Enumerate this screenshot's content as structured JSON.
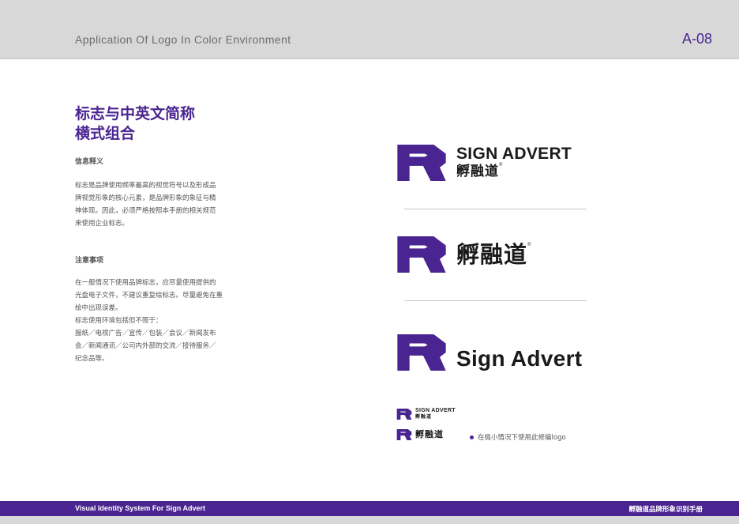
{
  "header": {
    "title": "Application Of Logo In Color Environment",
    "page_number": "A-08"
  },
  "left": {
    "title_line1": "标志与中英文简称",
    "title_line2": "横式组合",
    "section1_label": "信息释义",
    "section1_lines": [
      "标志是品牌使用频率最高的视觉符号以及形成品",
      "牌视觉形象的核心元素，是品牌形象的象征与精",
      "神体现。因此，必须严格按照本手册的相关规范",
      "来使用企业标志。"
    ],
    "section2_label": "注意事项",
    "section2_lines": [
      "在一般情况下使用品牌标志，应尽量使用提供的",
      "光盘电子文件，不建议重复绘标志。尽量避免在重",
      "绘中出现误差。",
      "标志使用环境包括但不限于：",
      "报纸／电视广告／宣传／包装／会议／新闻发布",
      "会／新闻通讯／公司内外部的交流／接待服务／",
      "纪念品等。"
    ]
  },
  "logos": {
    "brand_en_upper": "SIGN ADVERT",
    "brand_cn": "孵融道",
    "brand_en_mixed": "Sign Advert",
    "registered": "®",
    "small_note": "在极小情况下使用此修编logo"
  },
  "footer": {
    "left": "Visual Identity System For Sign Advert",
    "right": "孵融道品牌形象识别手册"
  },
  "colors": {
    "brand_purple": "#4a2591",
    "header_gray": "#d8d8d8",
    "text_dark": "#1a1a1a"
  }
}
